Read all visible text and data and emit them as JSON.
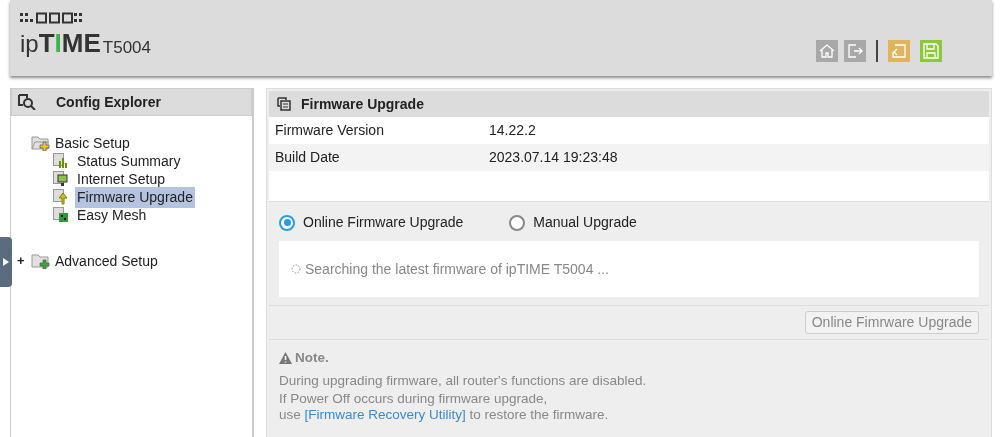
{
  "header": {
    "brand_parts": [
      {
        "text": "ip",
        "kind": "plain"
      },
      {
        "text": "T",
        "kind": "bold"
      },
      {
        "text": "I",
        "kind": "accent"
      },
      {
        "text": "ME",
        "kind": "bold"
      }
    ],
    "model": "T5004"
  },
  "explorer": {
    "title": "Config Explorer",
    "tree": [
      {
        "label": "Basic Setup",
        "expanded": true,
        "children": [
          {
            "label": "Status Summary",
            "kind": "chart",
            "selected": false
          },
          {
            "label": "Internet Setup",
            "kind": "monitor",
            "selected": false
          },
          {
            "label": "Firmware Upgrade",
            "kind": "upload",
            "selected": true
          },
          {
            "label": "Easy Mesh",
            "kind": "mesh",
            "selected": false
          }
        ]
      },
      {
        "label": "Advanced Setup",
        "expanded": false,
        "toggle": "+"
      }
    ]
  },
  "panel": {
    "title": "Firmware Upgrade",
    "info": [
      {
        "label": "Firmware Version",
        "value": "14.22.2"
      },
      {
        "label": "Build Date",
        "value": "2023.07.14 19:23:48"
      }
    ],
    "modes": [
      {
        "label": "Online Firmware Upgrade",
        "selected": true
      },
      {
        "label": "Manual Upgrade",
        "selected": false
      }
    ],
    "status": "Searching the latest firmware of ipTIME T5004 ...",
    "action_button": {
      "label": "Online Fimrware Upgrade",
      "disabled": true
    },
    "note": {
      "title": "Note.",
      "lines": [
        "During upgrading firmware, all router's functions are disabled.",
        "If Power Off occurs during firmware upgrade,"
      ],
      "last_before": "use ",
      "link": "[Firmware Recovery Utility]",
      "last_after": " to restore the firmware."
    }
  }
}
